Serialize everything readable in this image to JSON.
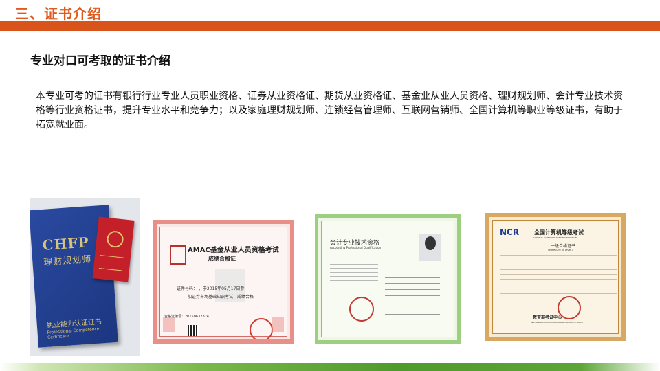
{
  "header": {
    "section_title": "三、证书介绍",
    "bar_color": "#d9541b",
    "title_color": "#e05a1e"
  },
  "main": {
    "subtitle": "专业对口可考取的证书介绍",
    "paragraph": "本专业可考的证书有银行行业专业人员职业资格、证券从业资格证、期货从业资格证、基金业从业人员资格、理财规划师、会计专业技术资格等行业资格证书，提升专业水平和竞争力；以及家庭理财规划师、连锁经营管理师、互联网营销师、全国计算机等职业等级证书，有助于拓宽就业面。"
  },
  "certificates": {
    "chfp": {
      "logo": "CHFP",
      "name": "理财规划师",
      "cn_caption": "执业能力认证证书",
      "en_caption": "Professional Competence Certificate"
    },
    "amac": {
      "title": "AMAC基金从业人员资格考试",
      "subtitle": "成绩合格证",
      "line1": "证件号码：           ，于2015年05月17日参",
      "line2": "加证券市场基础知识考试，成绩合格",
      "line3": "合格证编号：20150632824"
    },
    "accounting": {
      "title": "会计专业技术资格",
      "subtitle": "Accounting Professional Qualification"
    },
    "ncre": {
      "logo": "NCR",
      "title": "全国计算机等级考试",
      "title_en": "NATIONAL COMPUTER RANK EXAMINATION",
      "level": "一级合格证书",
      "level_en": "CERTIFICATE OF LEVEL 1",
      "authority": "教育部考试中心",
      "authority_en": "NATIONAL EDUCATION EXAMINATIONS AUTHORITY"
    }
  },
  "footer": {
    "bar_color": "#4f9a2c"
  }
}
